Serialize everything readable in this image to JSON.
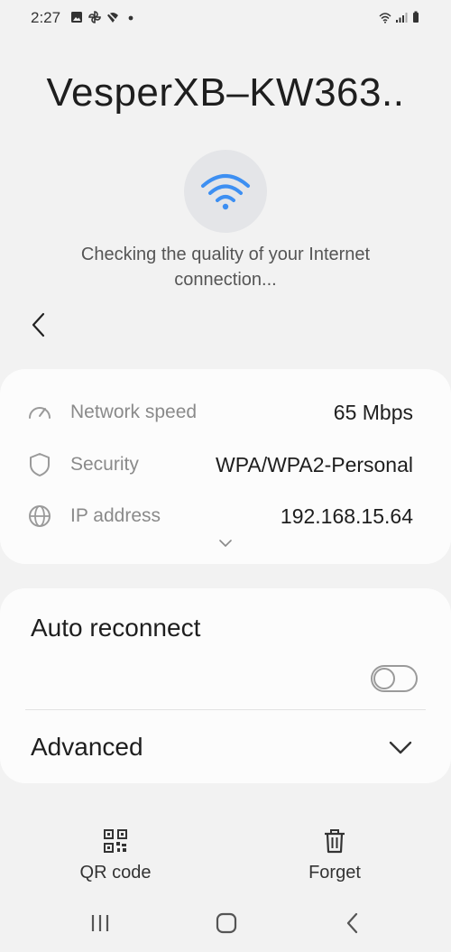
{
  "status_bar": {
    "time": "2:27",
    "left_icons": [
      "gallery-icon",
      "pinwheel-icon",
      "no-signal-icon",
      "dot-icon"
    ],
    "right_icons": [
      "wifi-signal-icon",
      "cell-signal-icon",
      "battery-icon"
    ]
  },
  "header": {
    "network_name": "VesperXB–KW363..",
    "checking_text": "Checking the quality of your Internet connection..."
  },
  "info": {
    "network_speed": {
      "label": "Network speed",
      "value": "65 Mbps",
      "icon": "speedometer-icon"
    },
    "security": {
      "label": "Security",
      "value": "WPA/WPA2-Personal",
      "icon": "shield-icon"
    },
    "ip_address": {
      "label": "IP address",
      "value": "192.168.15.64",
      "icon": "globe-icon"
    }
  },
  "settings": {
    "auto_reconnect_label": "Auto reconnect",
    "auto_reconnect_on": false,
    "advanced_label": "Advanced"
  },
  "actions": {
    "qr_label": "QR code",
    "forget_label": "Forget"
  },
  "colors": {
    "wifi_blue": "#3d8ff2",
    "background": "#f2f2f2",
    "card": "#fcfcfc"
  }
}
